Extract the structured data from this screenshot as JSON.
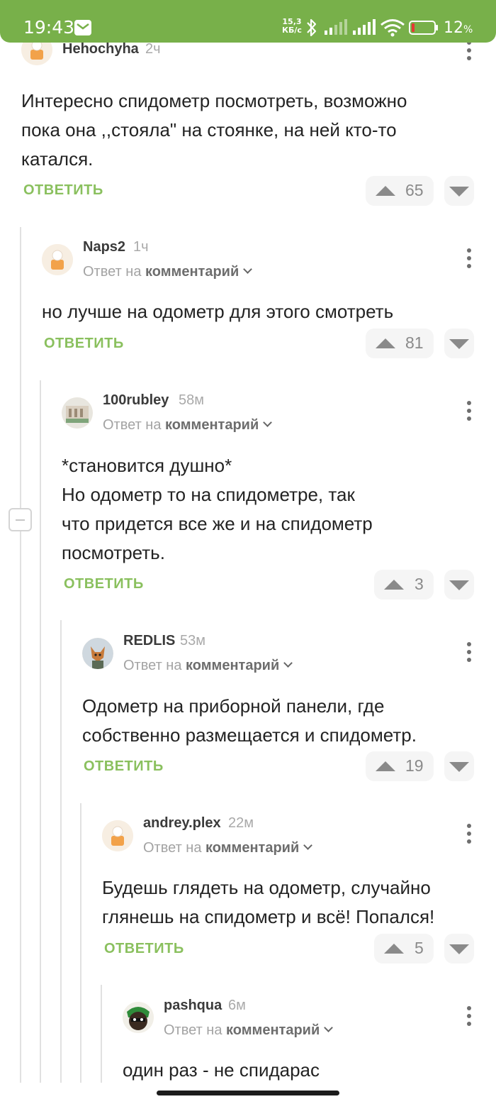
{
  "status_bar": {
    "time": "19:43",
    "net_speed": "15,3",
    "net_unit": "КБ/с",
    "battery_pct": "12",
    "battery_unit": "%",
    "icons": [
      "mail-icon",
      "bluetooth-icon",
      "signal-icon",
      "signal-icon",
      "wifi-icon",
      "battery-icon"
    ]
  },
  "labels": {
    "reply": "ОТВЕТИТЬ",
    "reply_to_prefix": "Ответ на",
    "reply_to_target": "комментарий"
  },
  "comments": [
    {
      "author": "Hehochyha",
      "time": "2ч",
      "text_lines": [
        "Интересно спидометр посмотреть, возможно",
        "пока она ,,стояла\" на стоянке, на ней кто-то",
        "катался."
      ],
      "rating": "65"
    },
    {
      "author": "Naps2",
      "time": "1ч",
      "text_lines": [
        "но лучше на одометр для этого смотреть"
      ],
      "rating": "81"
    },
    {
      "author": "100rubley",
      "time": "58м",
      "text_lines": [
        "*становится душно*",
        "Но одометр то на спидометре, так",
        "что придется все же и на спидометр",
        "посмотреть."
      ],
      "rating": "3"
    },
    {
      "author": "REDLIS",
      "time": "53м",
      "text_lines": [
        "Одометр на приборной панели, где",
        "собственно размещается и спидометр."
      ],
      "rating": "19"
    },
    {
      "author": "andrey.plex",
      "time": "22м",
      "text_lines": [
        "Будешь глядеть на одометр, случайно",
        "глянешь на спидометр и всё! Попался!"
      ],
      "rating": "5"
    },
    {
      "author": "pashqua",
      "time": "6м",
      "text_lines": [
        "один раз - не спидарас"
      ]
    }
  ],
  "colors": {
    "status_bar": "#78b04a",
    "reply_button": "#8ac05e",
    "thread_line": "#e1e1e1"
  }
}
